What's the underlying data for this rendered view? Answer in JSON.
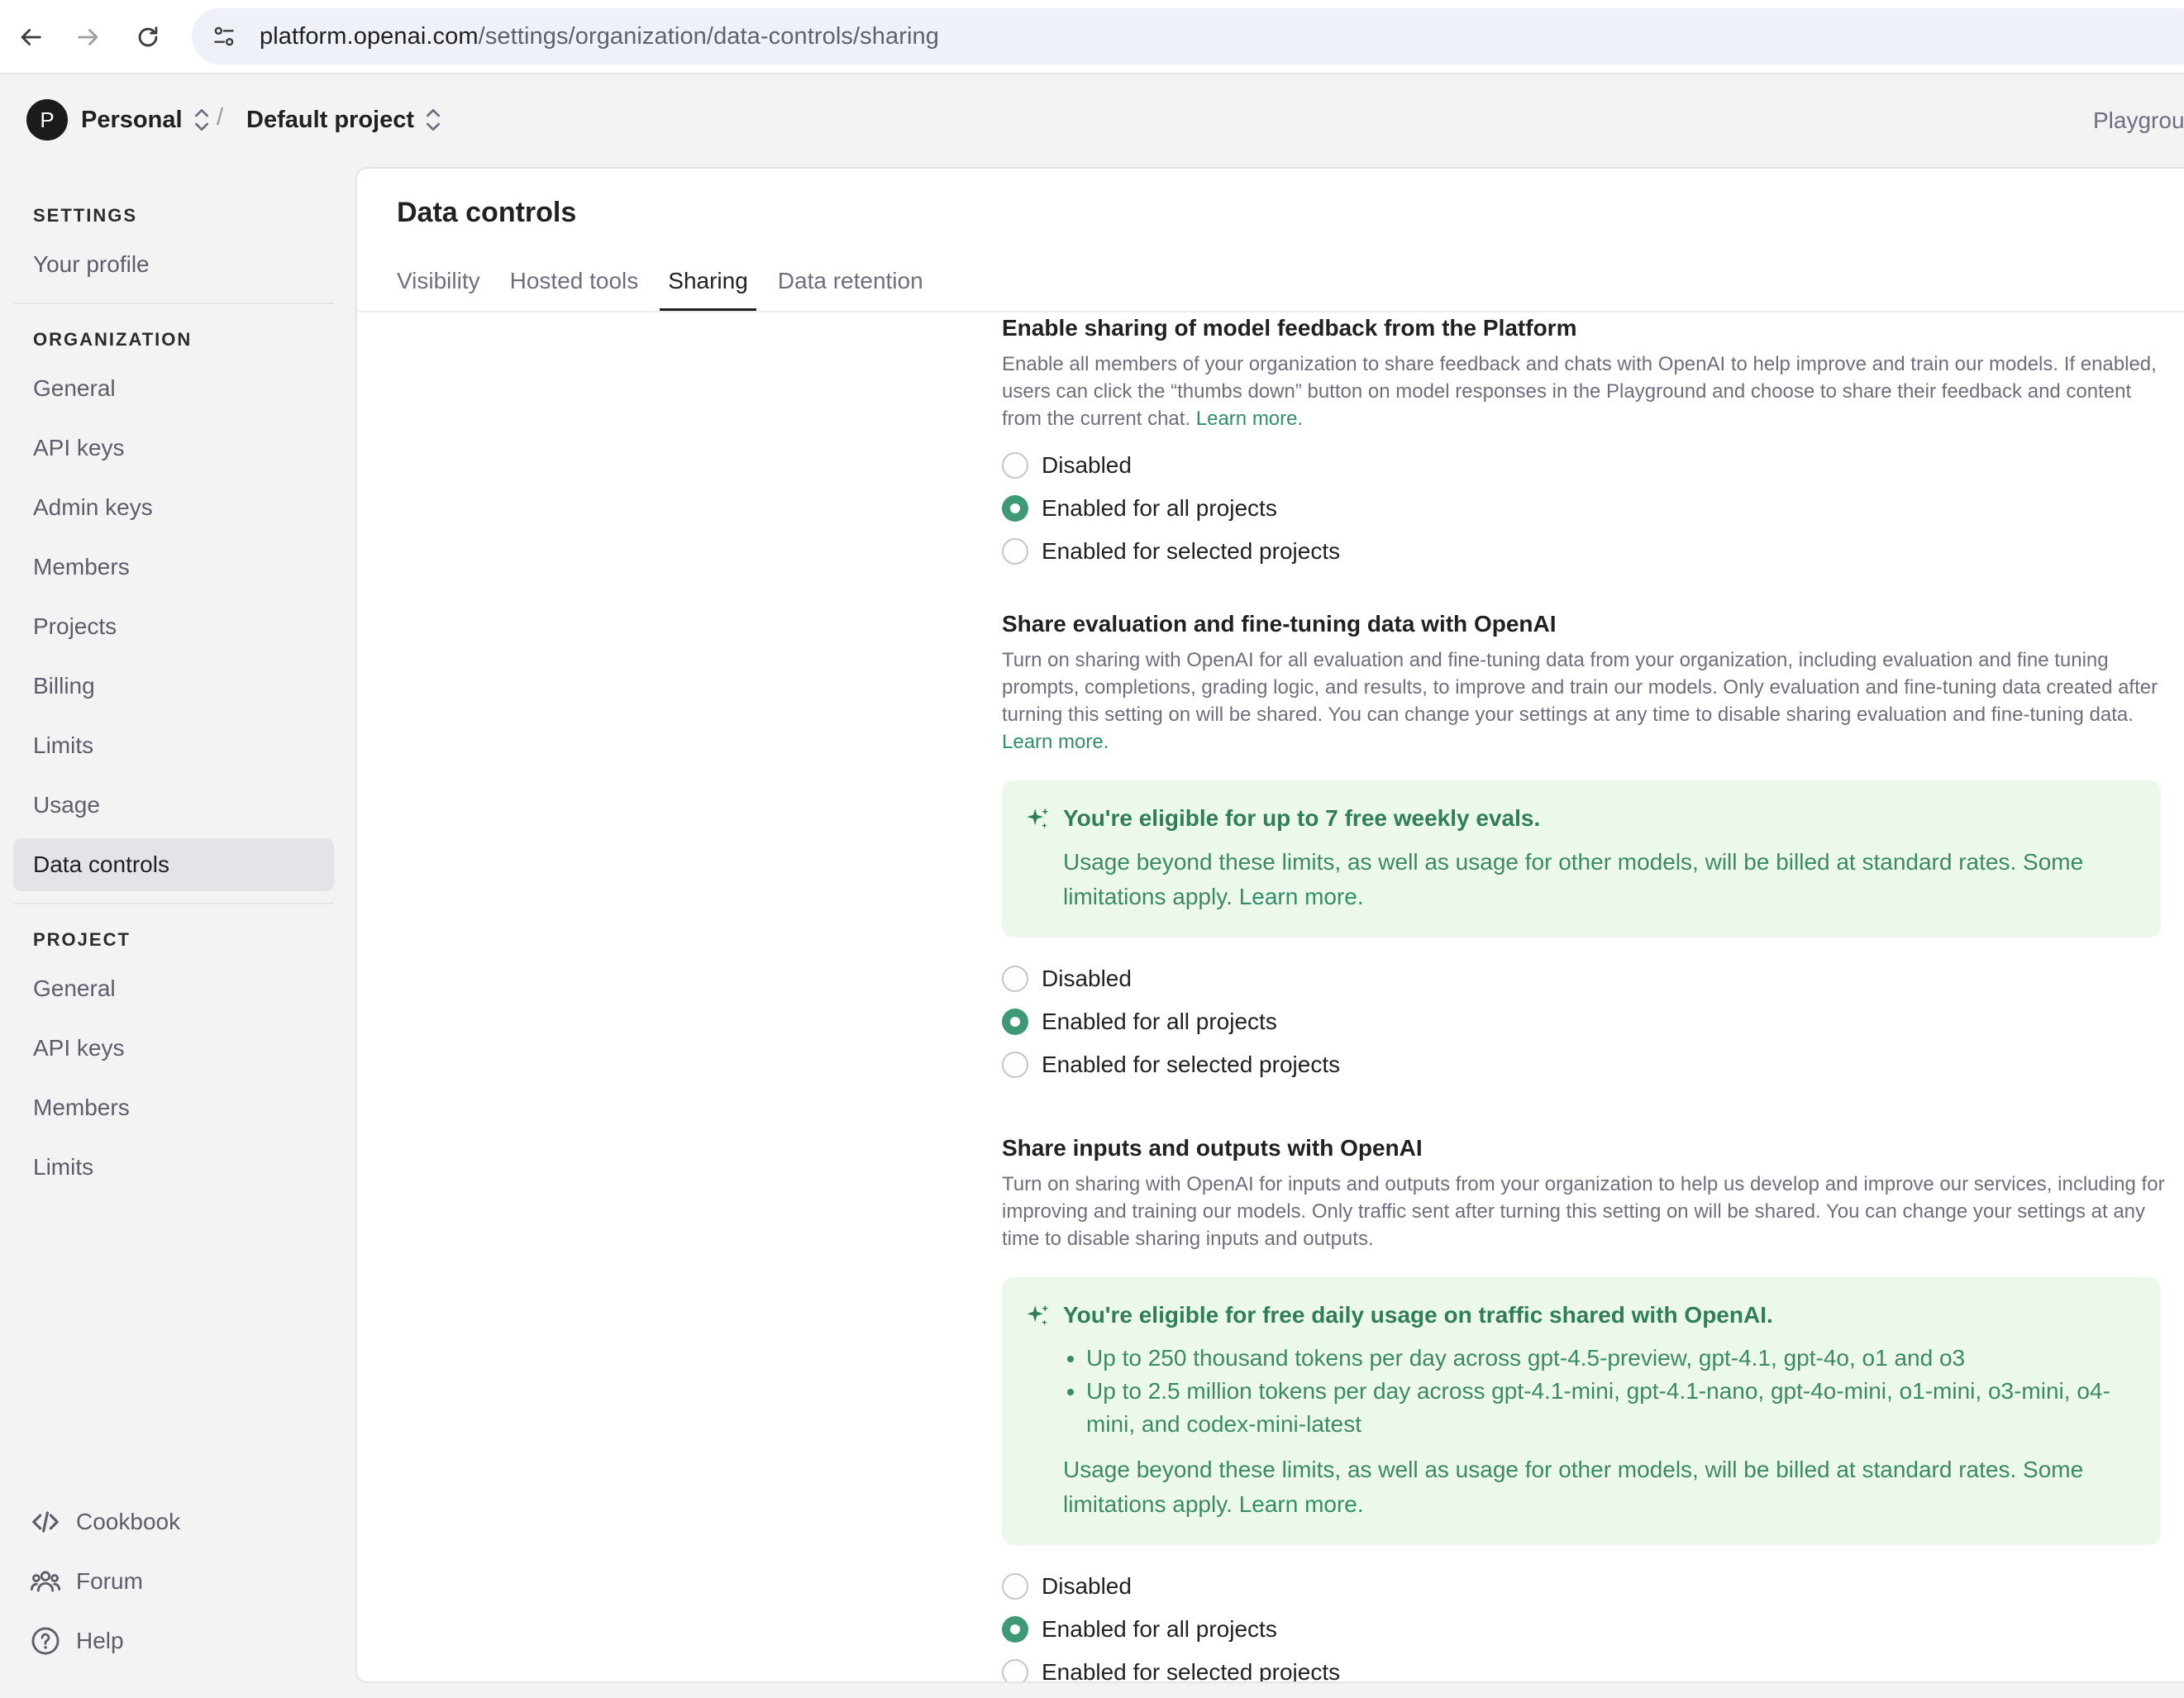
{
  "browser": {
    "url_host": "platform.openai.com",
    "url_path": "/settings/organization/data-controls/sharing"
  },
  "header": {
    "avatar_letter": "P",
    "org_name": "Personal",
    "separator": "/",
    "project_name": "Default project",
    "playground": "Playgrou"
  },
  "sidebar": {
    "settings_title": "SETTINGS",
    "your_profile": "Your profile",
    "org_title": "ORGANIZATION",
    "org_items": [
      "General",
      "API keys",
      "Admin keys",
      "Members",
      "Projects",
      "Billing",
      "Limits",
      "Usage",
      "Data controls"
    ],
    "project_title": "PROJECT",
    "project_items": [
      "General",
      "API keys",
      "Members",
      "Limits"
    ],
    "footer": {
      "cookbook": "Cookbook",
      "forum": "Forum",
      "help": "Help"
    }
  },
  "main": {
    "title": "Data controls",
    "tabs": [
      "Visibility",
      "Hosted tools",
      "Sharing",
      "Data retention"
    ],
    "active_tab": "Sharing",
    "learn_more": "Learn more.",
    "sections": [
      {
        "heading": "Enable sharing of model feedback from the Platform",
        "description": "Enable all members of your organization to share feedback and chats with OpenAI to help improve and train our models. If enabled, users can click the “thumbs down” button on model responses in the Playground and choose to share their feedback and content from the current chat.",
        "options": [
          "Disabled",
          "Enabled for all projects",
          "Enabled for selected projects"
        ],
        "selected": 1
      },
      {
        "heading": "Share evaluation and fine-tuning data with OpenAI",
        "description": "Turn on sharing with OpenAI for all evaluation and fine-tuning data from your organization, including evaluation and fine tuning prompts, completions, grading logic, and results, to improve and train our models. Only evaluation and fine-tuning data created after turning this setting on will be shared. You can change your settings at any time to disable sharing evaluation and fine-tuning data.",
        "callout_title": "You're eligible for up to 7 free weekly evals.",
        "callout_body": "Usage beyond these limits, as well as usage for other models, will be billed at standard rates. Some limitations apply.",
        "options": [
          "Disabled",
          "Enabled for all projects",
          "Enabled for selected projects"
        ],
        "selected": 1
      },
      {
        "heading": "Share inputs and outputs with OpenAI",
        "description": "Turn on sharing with OpenAI for inputs and outputs from your organization to help us develop and improve our services, including for improving and training our models. Only traffic sent after turning this setting on will be shared. You can change your settings at any time to disable sharing inputs and outputs.",
        "callout_title": "You're eligible for free daily usage on traffic shared with OpenAI.",
        "callout_bullets": [
          "Up to 250 thousand tokens per day across gpt-4.5-preview, gpt-4.1, gpt-4o, o1 and o3",
          "Up to 2.5 million tokens per day across gpt-4.1-mini, gpt-4.1-nano, gpt-4o-mini, o1-mini, o3-mini, o4-mini, and codex-mini-latest"
        ],
        "callout_body": "Usage beyond these limits, as well as usage for other models, will be billed at standard rates. Some limitations apply.",
        "options": [
          "Disabled",
          "Enabled for all projects",
          "Enabled for selected projects"
        ],
        "selected": 1
      }
    ]
  },
  "colors": {
    "accent_green": "#3e9a75",
    "callout_bg": "#edf8ed",
    "link_green": "#2f8f68"
  }
}
